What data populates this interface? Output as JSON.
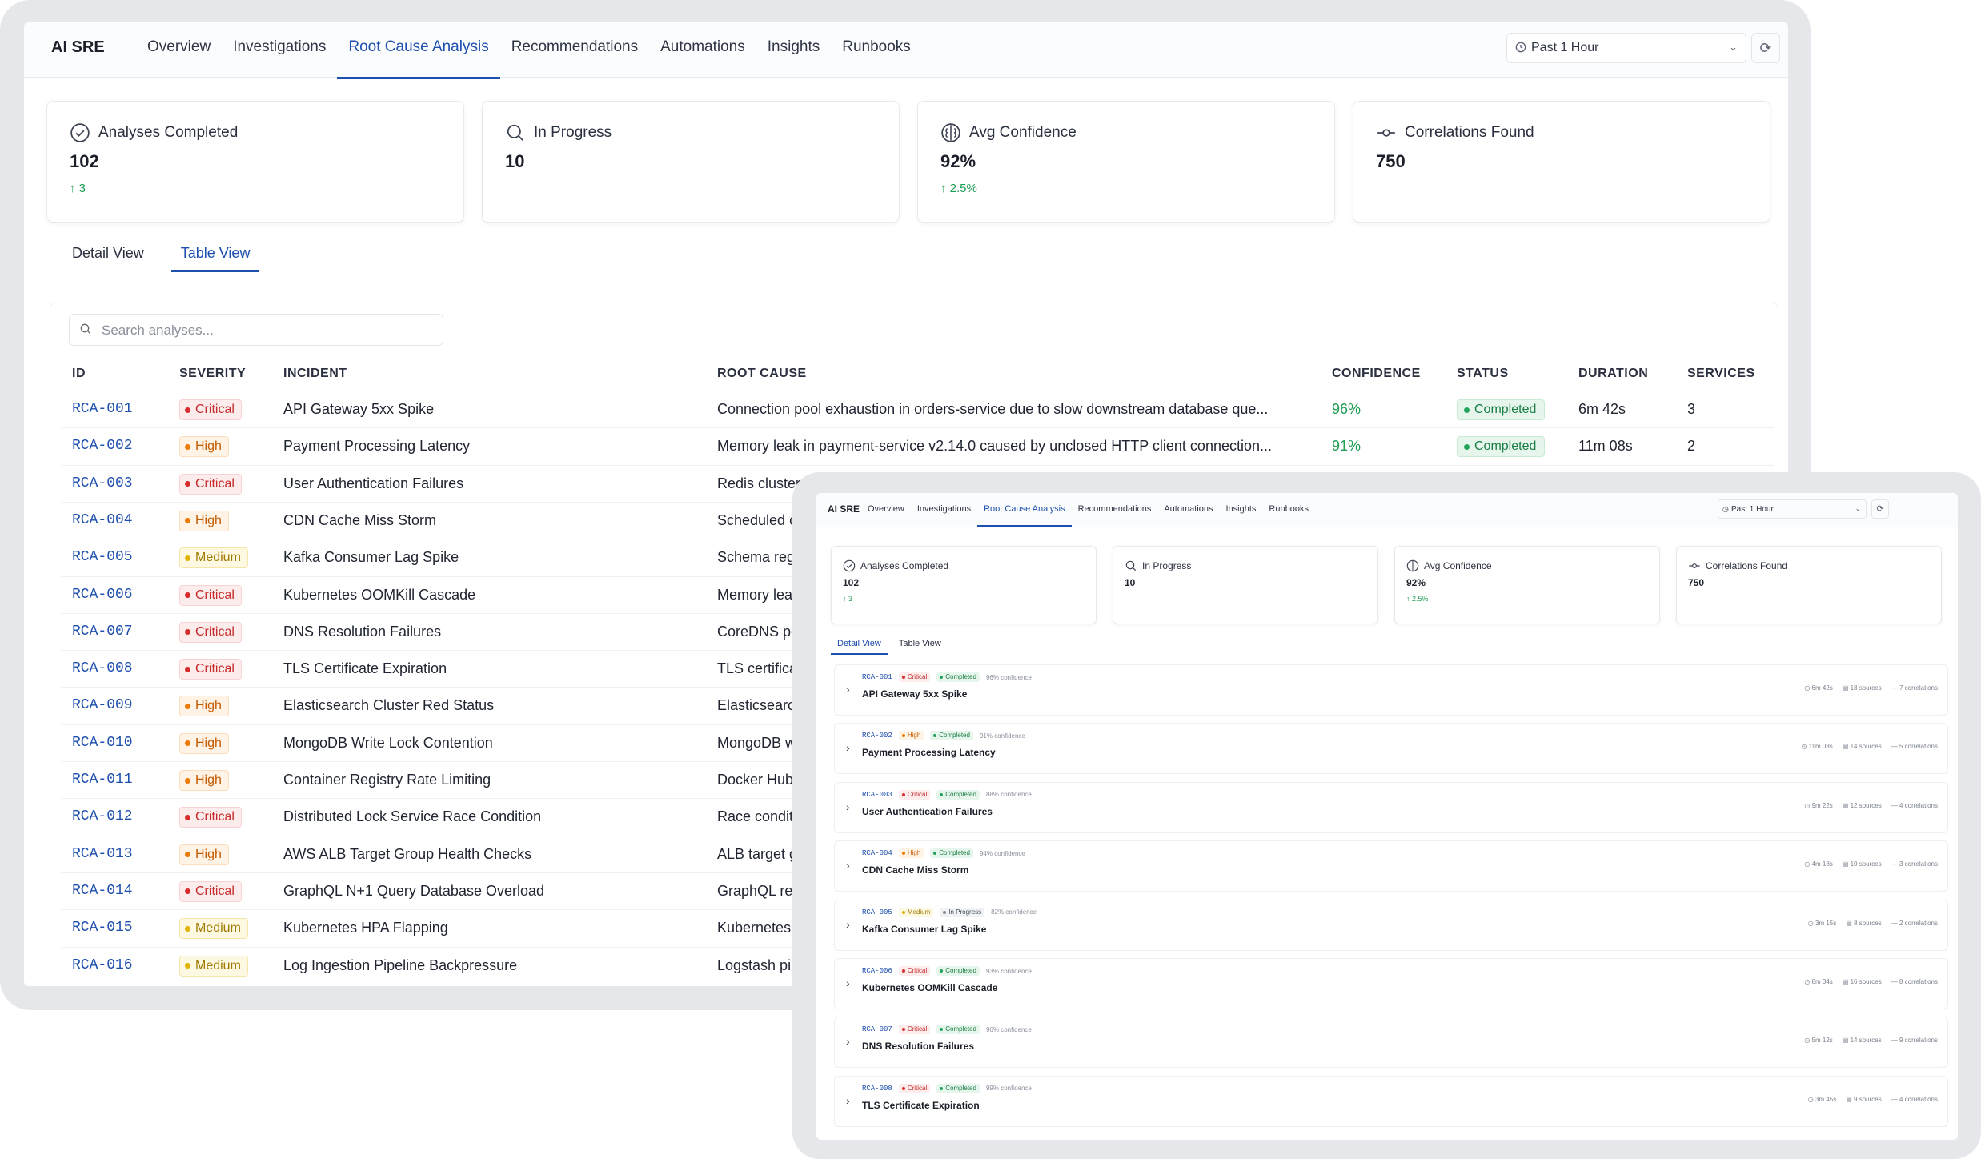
{
  "app": {
    "brand": "AI SRE",
    "nav": [
      "Overview",
      "Investigations",
      "Root Cause Analysis",
      "Recommendations",
      "Automations",
      "Insights",
      "Runbooks"
    ],
    "active_nav": "Root Cause Analysis",
    "time_range": "Past 1 Hour"
  },
  "stats": [
    {
      "title": "Analyses Completed",
      "value": "102",
      "delta": "3",
      "icon": "check-circle-icon"
    },
    {
      "title": "In Progress",
      "value": "10",
      "delta": "",
      "icon": "search-icon"
    },
    {
      "title": "Avg Confidence",
      "value": "92%",
      "delta": "2.5%",
      "icon": "brain-icon"
    },
    {
      "title": "Correlations Found",
      "value": "750",
      "delta": "",
      "icon": "link-icon"
    }
  ],
  "view_tabs": [
    "Detail View",
    "Table View"
  ],
  "search": {
    "placeholder": "Search analyses..."
  },
  "table": {
    "columns": [
      "ID",
      "SEVERITY",
      "INCIDENT",
      "ROOT CAUSE",
      "CONFIDENCE",
      "STATUS",
      "DURATION",
      "SERVICES"
    ],
    "rows": [
      {
        "id": "RCA-001",
        "severity": "Critical",
        "incident": "API Gateway 5xx Spike",
        "root_cause": "Connection pool exhaustion in orders-service due to slow downstream database que...",
        "confidence": "96%",
        "status": "Completed",
        "duration": "6m 42s",
        "services": "3"
      },
      {
        "id": "RCA-002",
        "severity": "High",
        "incident": "Payment Processing Latency",
        "root_cause": "Memory leak in payment-service v2.14.0 caused by unclosed HTTP client connection...",
        "confidence": "91%",
        "status": "Completed",
        "duration": "11m 08s",
        "services": "2"
      },
      {
        "id": "RCA-003",
        "severity": "Critical",
        "incident": "User Authentication Failures",
        "root_cause": "Redis cluster pa"
      },
      {
        "id": "RCA-004",
        "severity": "High",
        "incident": "CDN Cache Miss Storm",
        "root_cause": "Scheduled cach"
      },
      {
        "id": "RCA-005",
        "severity": "Medium",
        "incident": "Kafka Consumer Lag Spike",
        "root_cause": "Schema registr"
      },
      {
        "id": "RCA-006",
        "severity": "Critical",
        "incident": "Kubernetes OOMKill Cascade",
        "root_cause": "Memory leak ir"
      },
      {
        "id": "RCA-007",
        "severity": "Critical",
        "incident": "DNS Resolution Failures",
        "root_cause": "CoreDNS pod c"
      },
      {
        "id": "RCA-008",
        "severity": "Critical",
        "incident": "TLS Certificate Expiration",
        "root_cause": "TLS certificate f"
      },
      {
        "id": "RCA-009",
        "severity": "High",
        "incident": "Elasticsearch Cluster Red Status",
        "root_cause": "Elasticsearch cl"
      },
      {
        "id": "RCA-010",
        "severity": "High",
        "incident": "MongoDB Write Lock Contention",
        "root_cause": "MongoDB write"
      },
      {
        "id": "RCA-011",
        "severity": "High",
        "incident": "Container Registry Rate Limiting",
        "root_cause": "Docker Hub rat"
      },
      {
        "id": "RCA-012",
        "severity": "Critical",
        "incident": "Distributed Lock Service Race Condition",
        "root_cause": "Race condition"
      },
      {
        "id": "RCA-013",
        "severity": "High",
        "incident": "AWS ALB Target Group Health Checks",
        "root_cause": "ALB target grou"
      },
      {
        "id": "RCA-014",
        "severity": "Critical",
        "incident": "GraphQL N+1 Query Database Overload",
        "root_cause": "GraphQL resolv"
      },
      {
        "id": "RCA-015",
        "severity": "Medium",
        "incident": "Kubernetes HPA Flapping",
        "root_cause": "Kubernetes HP"
      },
      {
        "id": "RCA-016",
        "severity": "Medium",
        "incident": "Log Ingestion Pipeline Backpressure",
        "root_cause": "Logstash pipeli"
      }
    ]
  },
  "detail": {
    "active_tab": "Detail View",
    "items": [
      {
        "id": "RCA-001",
        "severity": "Critical",
        "status": "Completed",
        "confidence": "96% confidence",
        "title": "API Gateway 5xx Spike",
        "duration": "6m 42s",
        "sources": "18 sources",
        "correlations": "7 correlations"
      },
      {
        "id": "RCA-002",
        "severity": "High",
        "status": "Completed",
        "confidence": "91% confidence",
        "title": "Payment Processing Latency",
        "duration": "11m 08s",
        "sources": "14 sources",
        "correlations": "5 correlations"
      },
      {
        "id": "RCA-003",
        "severity": "Critical",
        "status": "Completed",
        "confidence": "88% confidence",
        "title": "User Authentication Failures",
        "duration": "9m 22s",
        "sources": "12 sources",
        "correlations": "4 correlations"
      },
      {
        "id": "RCA-004",
        "severity": "High",
        "status": "Completed",
        "confidence": "94% confidence",
        "title": "CDN Cache Miss Storm",
        "duration": "4m 18s",
        "sources": "10 sources",
        "correlations": "3 correlations"
      },
      {
        "id": "RCA-005",
        "severity": "Medium",
        "status": "In Progress",
        "confidence": "82% confidence",
        "title": "Kafka Consumer Lag Spike",
        "duration": "3m 15s",
        "sources": "8 sources",
        "correlations": "2 correlations"
      },
      {
        "id": "RCA-006",
        "severity": "Critical",
        "status": "Completed",
        "confidence": "93% confidence",
        "title": "Kubernetes OOMKill Cascade",
        "duration": "8m 34s",
        "sources": "16 sources",
        "correlations": "8 correlations"
      },
      {
        "id": "RCA-007",
        "severity": "Critical",
        "status": "Completed",
        "confidence": "96% confidence",
        "title": "DNS Resolution Failures",
        "duration": "5m 12s",
        "sources": "14 sources",
        "correlations": "9 correlations"
      },
      {
        "id": "RCA-008",
        "severity": "Critical",
        "status": "Completed",
        "confidence": "99% confidence",
        "title": "TLS Certificate Expiration",
        "duration": "3m 45s",
        "sources": "9 sources",
        "correlations": "4 correlations"
      }
    ]
  },
  "colors": {
    "accent": "#1d4fae",
    "success": "#1f9d55",
    "critical": "#d92d2d",
    "high": "#ef7a00",
    "medium": "#e1b400"
  }
}
